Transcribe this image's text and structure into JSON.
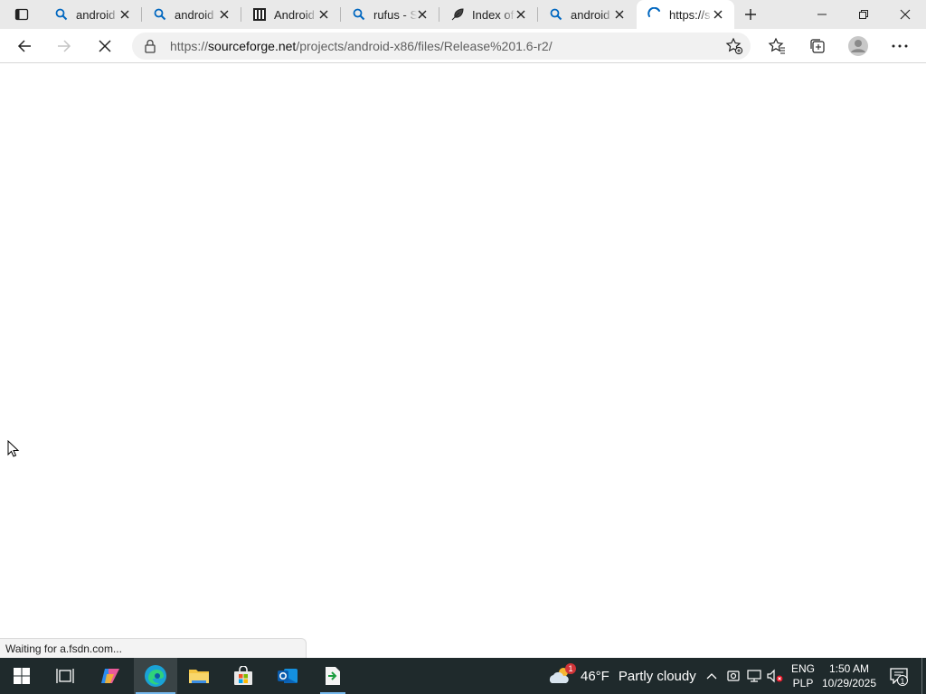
{
  "browser": {
    "tabs": [
      {
        "label": "android",
        "icon": "search-icon",
        "active": false
      },
      {
        "label": "android",
        "icon": "search-icon",
        "active": false
      },
      {
        "label": "Android",
        "icon": "site-columns-icon",
        "active": false
      },
      {
        "label": "rufus - S",
        "icon": "search-icon",
        "active": false
      },
      {
        "label": "Index of",
        "icon": "feather-icon",
        "active": false
      },
      {
        "label": "android",
        "icon": "search-icon",
        "active": false
      },
      {
        "label": "https://s",
        "icon": "loading-spinner-icon",
        "active": true
      }
    ],
    "address": {
      "prefix": "https://",
      "host": "sourceforge.net",
      "path": "/projects/android-x86/files/Release%201.6-r2/"
    },
    "status_text": "Waiting for a.fsdn.com...",
    "colors": {
      "accent": "#0067c0",
      "tabstrip": "#e9e9e9"
    }
  },
  "taskbar": {
    "weather": {
      "temp": "46°F",
      "desc": "Partly cloudy",
      "alert_count": "1"
    },
    "language": {
      "line1": "ENG",
      "line2": "PLP"
    },
    "clock": {
      "time": "1:50 AM",
      "date": "10/29/2025"
    },
    "notification_count": "1"
  }
}
